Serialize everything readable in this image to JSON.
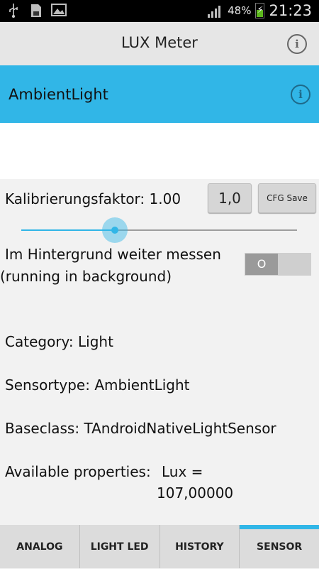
{
  "status_bar": {
    "battery_percent": "48%",
    "time": "21:23",
    "icons": [
      "usb-icon",
      "sd-card-icon",
      "image-icon",
      "signal-icon",
      "battery-charging-icon"
    ]
  },
  "header": {
    "title": "LUX Meter"
  },
  "sensor_bar": {
    "name": "AmbientLight"
  },
  "calibration": {
    "label": "Kalibrierungsfaktor: 1.00",
    "value_button": "1,0",
    "save_button": "CFG Save",
    "slider_fraction": 0.34
  },
  "background": {
    "label_line1": "Im Hintergrund weiter messen",
    "label_line2": "(running in background)",
    "toggle_text": "O"
  },
  "info": {
    "category": "Category: Light",
    "sensortype": "Sensortype: AmbientLight",
    "baseclass": "Baseclass: TAndroidNativeLightSensor",
    "properties_label": "Available properties:",
    "properties_value_line1": "Lux =",
    "properties_value_line2": "107,00000"
  },
  "tabs": [
    {
      "label": "ANALOG",
      "active": false
    },
    {
      "label": "LIGHT LED",
      "active": false
    },
    {
      "label": "HISTORY",
      "active": false
    },
    {
      "label": "SENSOR",
      "active": true
    }
  ],
  "colors": {
    "accent": "#31b6e7"
  }
}
